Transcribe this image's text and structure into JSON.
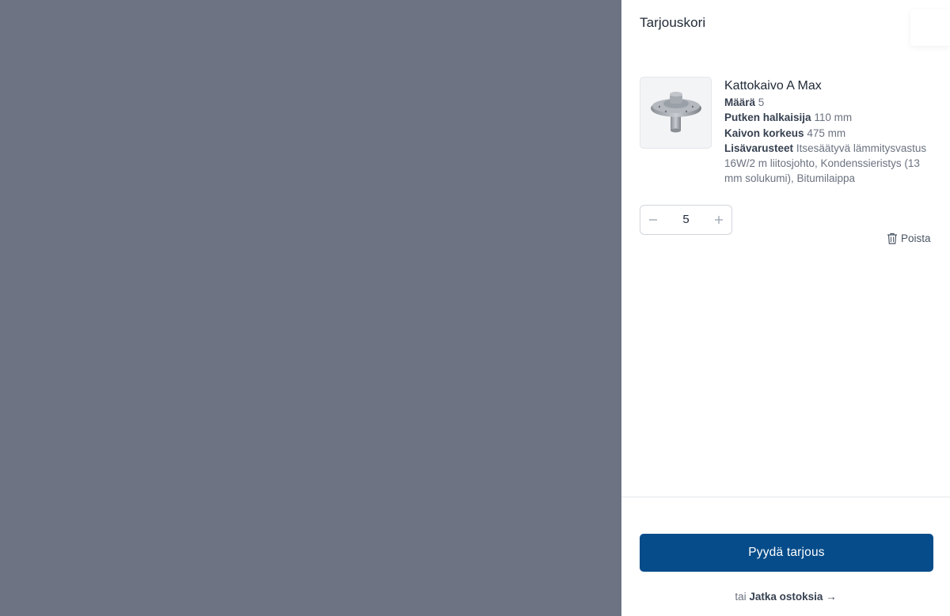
{
  "drawer": {
    "title": "Tarjouskori"
  },
  "cart_item": {
    "name": "Kattokaivo A Max",
    "specs": [
      {
        "label": "Määrä",
        "value": "5"
      },
      {
        "label": "Putken halkaisija",
        "value": "110 mm"
      },
      {
        "label": "Kaivon korkeus",
        "value": "475 mm"
      },
      {
        "label": "Lisävarusteet",
        "value": "Itsesäätyvä lämmitysvastus 16W/2 m liitosjohto, Kondenssieristys (13 mm solukumi), Bitumilaippa"
      }
    ],
    "quantity": "5",
    "remove_label": "Poista",
    "image_icon": "roof-drain-image"
  },
  "footer": {
    "cta_label": "Pyydä tarjous",
    "continue_prefix": "tai",
    "continue_link": "Jatka ostoksia →"
  },
  "colors": {
    "overlay": "#6d7382",
    "primary": "#064c8a"
  }
}
